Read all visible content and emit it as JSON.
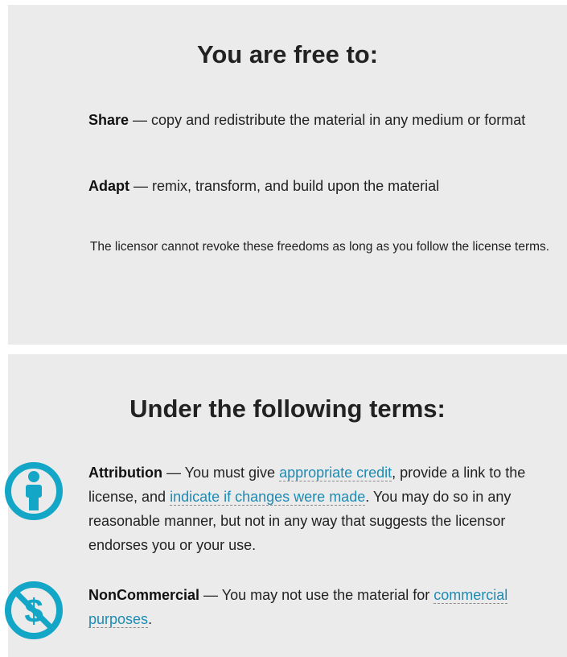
{
  "freedoms": {
    "title": "You are free to:",
    "share": {
      "term": "Share",
      "dash": " — ",
      "desc": "copy and redistribute the material in any medium or format"
    },
    "adapt": {
      "term": "Adapt",
      "dash": " — ",
      "desc": "remix, transform, and build upon the material"
    },
    "note": "The licensor cannot revoke these freedoms as long as you follow the license terms."
  },
  "terms": {
    "title": "Under the following terms:",
    "attribution": {
      "icon": "attribution-person-icon",
      "term": "Attribution",
      "dash": " — ",
      "text1": "You must give ",
      "link1": "appropriate credit",
      "text2": ", provide a link to the license, and ",
      "link2": "indicate if changes were made",
      "text3": ". You may do so in any reasonable manner, but not in any way that suggests the licensor endorses you or your use."
    },
    "noncommercial": {
      "icon": "noncommercial-dollar-icon",
      "term": "NonCommercial",
      "dash": " — ",
      "text1": "You may not use the material for ",
      "link1": "commercial purposes",
      "text2": "."
    }
  },
  "colors": {
    "panel_bg": "#ebebeb",
    "link": "#1d8bb3",
    "icon": "#14a6c6",
    "text": "#222222"
  }
}
